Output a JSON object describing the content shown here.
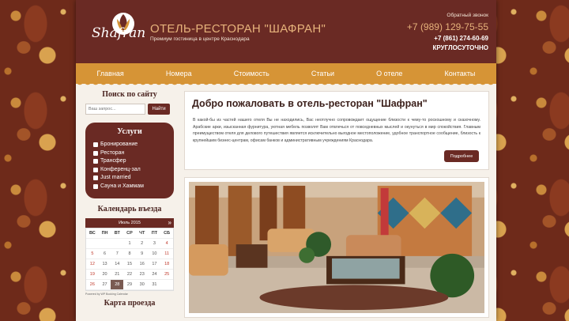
{
  "header": {
    "logo_text": "Shafran",
    "title": "ОТЕЛЬ-РЕСТОРАН \"ШАФРАН\"",
    "subtitle": "Премиум гостиница в центре Краснодара",
    "callback_label": "Обратный звонок",
    "phone_main": "+7 (989) 129-75-55",
    "phone_second": "+7 (861) 274-60-69",
    "hours": "КРУГЛОСУТОЧНО"
  },
  "nav": {
    "items": [
      "Главная",
      "Номера",
      "Стоимость",
      "Статьи",
      "О отеле",
      "Контакты"
    ]
  },
  "sidebar": {
    "search_title": "Поиск по сайту",
    "search_placeholder": "Ваш запрос...",
    "search_button": "Найти",
    "services_title": "Услуги",
    "services": [
      "Бронирование",
      "Ресторан",
      "Трансфер",
      "Конференц-зал",
      "Just married",
      "Сауна и Хаммам"
    ],
    "calendar_title": "Календарь въезда",
    "calendar_month": "Июль 2015",
    "calendar_next": "»",
    "weekdays": [
      "ВС",
      "ПН",
      "ВТ",
      "СР",
      "ЧТ",
      "ПТ",
      "СБ"
    ],
    "calendar_rows": [
      [
        "",
        "",
        "",
        "1",
        "2",
        "3",
        "4"
      ],
      [
        "5",
        "6",
        "7",
        "8",
        "9",
        "10",
        "11"
      ],
      [
        "12",
        "13",
        "14",
        "15",
        "16",
        "17",
        "18"
      ],
      [
        "19",
        "20",
        "21",
        "22",
        "23",
        "24",
        "25"
      ],
      [
        "26",
        "27",
        "28",
        "29",
        "30",
        "31",
        ""
      ]
    ],
    "calendar_today": "28",
    "calendar_note": "Powered by WP Booking Calendar",
    "map_title": "Карта проезда"
  },
  "welcome": {
    "heading": "Добро пожаловать в отель-ресторан \"Шафран\"",
    "text": "В какой-бы из частей нашего отеля Вы не находились, Вас неотлучно сопровождает ощущение близости к чему-то роскошному и сказочному. Арабские арки, изысканная фурнитура, уютная мебель позволят Вам отвлечься от повседневных мыслей и окунуться в мир спокойствия. Главным преимуществом отеля для делового путешествия является исключительно выгодное местоположение, удобное транспортное сообщение, близость к крупнейшим бизнес-центрам, офисам банков и административным учреждениям Краснодара.",
    "more_button": "Подробнее"
  },
  "colors": {
    "brand": "#6a2a24",
    "accent": "#d69436",
    "title_gold": "#e6b27b"
  }
}
